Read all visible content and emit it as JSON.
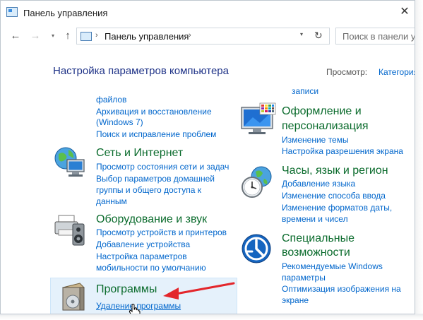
{
  "window": {
    "title": "Панель управления",
    "close_label": "✕"
  },
  "toolbar": {
    "back_icon": "←",
    "forward_icon": "→",
    "dropdown_icon": "▾",
    "up_icon": "↑",
    "address_sep": "›",
    "address_text": "Панель управления",
    "address_dropdown": "▾",
    "refresh_icon": "↻",
    "search_placeholder": "Поиск в панели управления"
  },
  "header": {
    "title": "Настройка параметров компьютера",
    "view_label": "Просмотр:",
    "view_value": "Категория"
  },
  "left": {
    "partial_top": "файлов",
    "system_links": [
      "Архивация и восстановление",
      "(Windows 7)",
      "Поиск и исправление проблем"
    ],
    "network": {
      "title": "Сеть и Интернет",
      "links": [
        "Просмотр состояния сети и задач",
        "Выбор параметров домашней",
        "группы и общего доступа к",
        "данным"
      ]
    },
    "hardware": {
      "title": "Оборудование и звук",
      "links": [
        "Просмотр устройств и принтеров",
        "Добавление устройства",
        "Настройка параметров",
        "мобильности по умолчанию"
      ]
    },
    "programs": {
      "title": "Программы",
      "links": [
        "Удаление программы"
      ]
    }
  },
  "right": {
    "partial_top": "записи",
    "appearance": {
      "title_lines": [
        "Оформление и",
        "персонализация"
      ],
      "links": [
        "Изменение темы",
        "Настройка разрешения экрана"
      ]
    },
    "clock": {
      "title": "Часы, язык и регион",
      "links": [
        "Добавление языка",
        "Изменение способа ввода",
        "Изменение форматов даты,",
        "времени и чисел"
      ]
    },
    "access": {
      "title_lines": [
        "Специальные",
        "возможности"
      ],
      "links": [
        "Рекомендуемые Windows",
        "параметры",
        "Оптимизация изображения на",
        "экране"
      ]
    }
  },
  "colors": {
    "category_green": "#0a6b2c",
    "link_blue": "#0066cc",
    "title_navy": "#1e3287",
    "highlight": "#e5f1fb",
    "arrow_red": "#e3262b"
  }
}
